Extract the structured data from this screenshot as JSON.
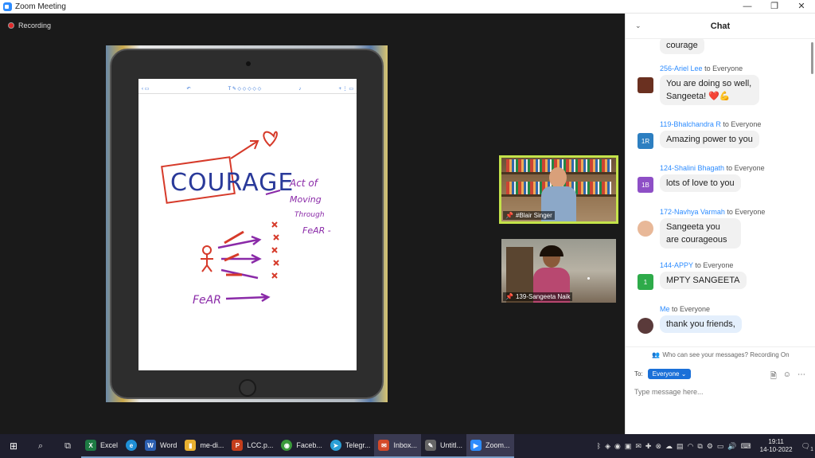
{
  "window": {
    "title": "Zoom Meeting",
    "minimize": "—",
    "maximize": "❐",
    "close": "✕"
  },
  "recording": {
    "label": "Recording"
  },
  "whiteboard": {
    "words": {
      "main": "COURAGE",
      "line1": "Act of",
      "line2": "Moving",
      "line3": "Through",
      "line4": "FeAR -",
      "bottom": "FeAR"
    }
  },
  "participants": [
    {
      "name": "#Blair Singer"
    },
    {
      "name": "139-Sangeeta Naik"
    }
  ],
  "chat": {
    "title": "Chat",
    "messages": [
      {
        "sender": "",
        "to": "",
        "text": "courage",
        "avatar": "",
        "color": ""
      },
      {
        "sender": "256-Ariel Lee",
        "to": "to Everyone",
        "text": "You are doing so well, Sangeeta! ❤️💪",
        "avatar": "",
        "color": "#6a3020"
      },
      {
        "sender": "119-Bhalchandra R",
        "to": "to Everyone",
        "text": "Amazing power to you",
        "avatar": "1R",
        "color": "#2d7fc1"
      },
      {
        "sender": "124-Shalini Bhagath",
        "to": "to Everyone",
        "text": "lots of love to you",
        "avatar": "1B",
        "color": "#8e4fc6"
      },
      {
        "sender": "172-Navhya Varmah",
        "to": "to Everyone",
        "text": "Sangeeta you are courageous",
        "avatar": "",
        "color": "#e8b898"
      },
      {
        "sender": "144-APPY",
        "to": "to Everyone",
        "text": "MPTY SANGEETA",
        "avatar": "1",
        "color": "#2eab4a"
      },
      {
        "sender": "Me",
        "to": "to Everyone",
        "text": "thank you friends,",
        "avatar": "",
        "color": "#5a3a3a"
      }
    ],
    "privacy": "Who can see your messages? Recording On",
    "to_label": "To:",
    "to_value": "Everyone",
    "input_placeholder": "Type message here..."
  },
  "taskbar": {
    "apps": [
      {
        "label": "Excel",
        "icon": "X",
        "color": "#1d7a43"
      },
      {
        "label": "",
        "icon": "e",
        "color": "#1f8fd6"
      },
      {
        "label": "Word",
        "icon": "W",
        "color": "#2b5eb0"
      },
      {
        "label": "me-di...",
        "icon": "▮",
        "color": "#e8b030"
      },
      {
        "label": "LCC.p...",
        "icon": "P",
        "color": "#c43e1c"
      },
      {
        "label": "Faceb...",
        "icon": "◉",
        "color": "#3a9a3a"
      },
      {
        "label": "Telegr...",
        "icon": "➤",
        "color": "#2a9fd6"
      },
      {
        "label": "Inbox...",
        "icon": "✉",
        "color": "#d44a2a"
      },
      {
        "label": "Untitl...",
        "icon": "✎",
        "color": "#666"
      },
      {
        "label": "Zoom...",
        "icon": "▶",
        "color": "#2d8cff"
      }
    ],
    "time": "19:11",
    "date": "14-10-2022",
    "notifications": "1"
  }
}
